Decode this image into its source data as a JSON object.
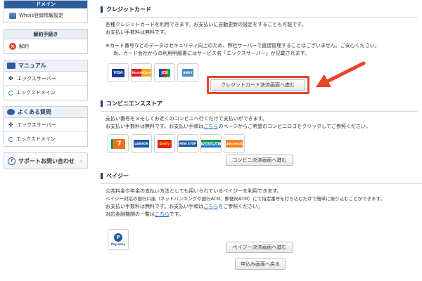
{
  "sidebar": {
    "domain_header": "ドメイン",
    "whois_label": "Whois登録情報設定",
    "cancel_header": "解約手続き",
    "cancel_label": "解約",
    "manual": {
      "title": "マニュアル",
      "items": [
        "エックスサーバー",
        "エックスドメイン"
      ]
    },
    "faq": {
      "title": "よくある質問",
      "items": [
        "エックスサーバー",
        "エックスドメイン"
      ]
    },
    "support_label": "サポートお問い合わせ"
  },
  "credit": {
    "title": "クレジットカード",
    "lines": [
      "各種クレジットカードを利用できます。お支払いに自動更新の設定をすることも可能です。",
      "お支払い手数料は無料です。"
    ],
    "note1": "※カード番号などのデータはセキュリティ向上のため、弊社サーバーで直接管理することはございません。ご安心ください。",
    "note2": "尚、カード会社からの利用明細書にはサービス名「エックスサーバー」が記載されます。",
    "logos": [
      "VISA",
      "MasterCard",
      "JCB",
      "AMEX"
    ],
    "button": "クレジットカード決済画面へ進む"
  },
  "conveni": {
    "title": "コンビニエンスストア",
    "line1": "支払い番号をメモしてお近くのコンビニへ行くだけで支払いができます。",
    "line2_pre": "お支払い手数料は無料です。お支払い手順は",
    "line2_link": "こちら",
    "line2_post": "のページからご希望のコンビニロゴをクリックしてご参照ください。",
    "logos": [
      "7",
      "LAWSON",
      "Daily",
      "MINI STOP",
      "FamilyMart",
      "Seicomart"
    ],
    "button": "コンビニ決済画面へ進む"
  },
  "payeasy": {
    "title": "ペイジー",
    "line1": "公共料金や年金の支払い方法としても用いられているペイジーを利用できます。",
    "line2": "ペイジー対応の銀行口座（ネットバンキングや銀行ATM、郵便局ATM）にて指定番号を打ち込むだけで簡単に振り込むことができます。",
    "line3_pre": "お支払い手数料は無料です。お支払い手順は",
    "line3_link": "こちら",
    "line3_post": "をご参照ください。",
    "line4_pre": "対応金融機関の一覧は",
    "line4_link": "こちら",
    "line4_post": "です。",
    "logo": "Pay-easy",
    "button": "ペイジー決済画面へ進む"
  },
  "back_button": "申込み画面へ戻る",
  "colors": {
    "accent_red": "#e7452c",
    "nav_blue": "#2f5d9e",
    "link": "#2166c4"
  }
}
